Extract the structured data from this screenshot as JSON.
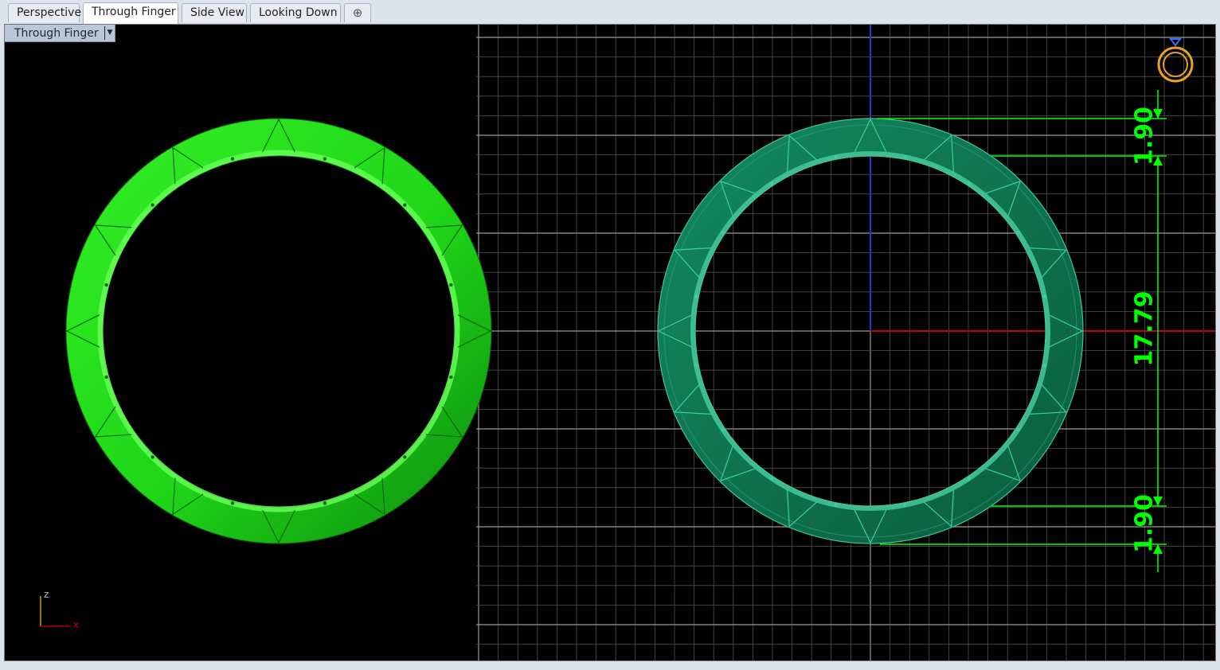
{
  "tabs": [
    {
      "label": "Perspective",
      "active": false
    },
    {
      "label": "Through Finger",
      "active": true
    },
    {
      "label": "Side View",
      "active": false
    },
    {
      "label": "Looking Down",
      "active": false
    }
  ],
  "tab_add_icon": "plus-icon",
  "viewport": {
    "label": "Through Finger",
    "dropdown_icon": "chevron-down-icon",
    "background": "#000000"
  },
  "axis_widget": {
    "z_label": "z",
    "x_label": "x"
  },
  "dimensions": {
    "top_thickness": "1.90",
    "inner_diameter": "17.79",
    "bottom_thickness": "1.90",
    "color": "#00ff00"
  },
  "colors": {
    "ring_left": "#22e01a",
    "ring_right": "#0f7a55",
    "grid_line": "#5e5e5e",
    "grid_major": "#9a9a9a",
    "axis_x": "#c00000",
    "axis_y": "#1a3cc8",
    "ring_icon": "#e8a320"
  }
}
